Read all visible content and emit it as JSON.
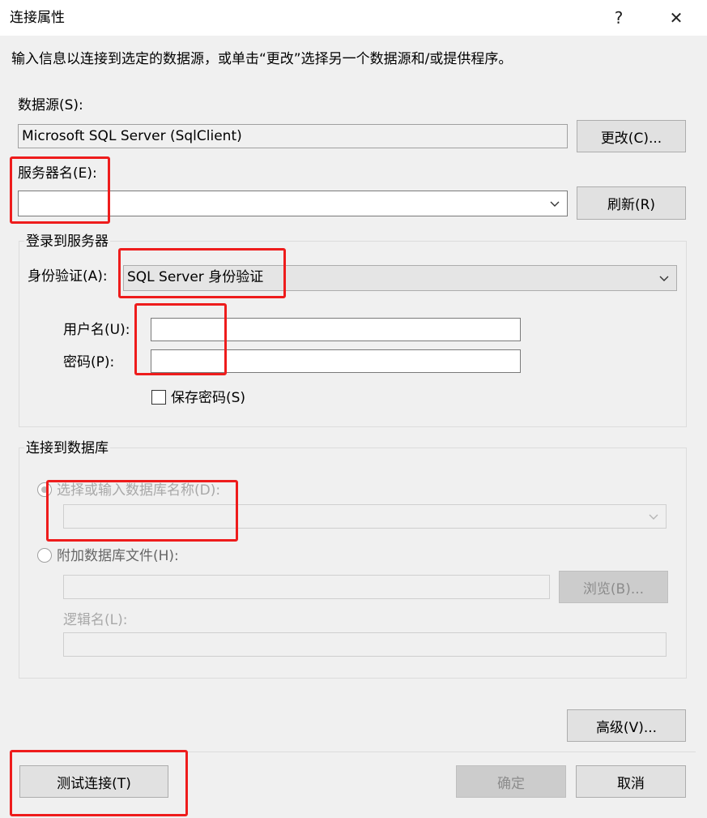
{
  "window": {
    "title": "连接属性",
    "help_symbol": "?",
    "close_symbol": "✕"
  },
  "instruction": "输入信息以连接到选定的数据源，或单击“更改”选择另一个数据源和/或提供程序。",
  "data_source": {
    "label": "数据源(S):",
    "value": "Microsoft SQL Server (SqlClient)",
    "change_button": "更改(C)..."
  },
  "server": {
    "label": "服务器名(E):",
    "value": "",
    "refresh_button": "刷新(R)"
  },
  "login": {
    "group_label": "登录到服务器",
    "auth_label": "身份验证(A):",
    "auth_value": "SQL Server 身份验证",
    "username_label": "用户名(U):",
    "username_value": "",
    "password_label": "密码(P):",
    "password_value": "",
    "save_password_label": "保存密码(S)",
    "save_password_checked": false
  },
  "database": {
    "group_label": "连接到数据库",
    "select_radio_label": "选择或输入数据库名称(D):",
    "select_value": "",
    "attach_radio_label": "附加数据库文件(H):",
    "attach_value": "",
    "browse_button": "浏览(B)...",
    "logical_name_label": "逻辑名(L):",
    "logical_name_value": ""
  },
  "footer": {
    "advanced_button": "高级(V)...",
    "test_button": "测试连接(T)",
    "ok_button": "确定",
    "cancel_button": "取消"
  },
  "colors": {
    "highlight_box": "#ee1c1c",
    "dialog_background": "#f0f0f0",
    "title_background": "#ffffff"
  }
}
